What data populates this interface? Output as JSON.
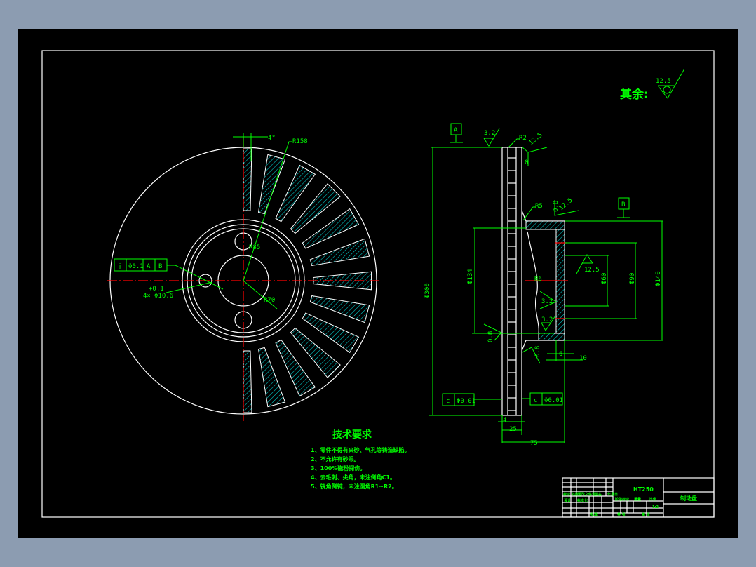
{
  "drawing": {
    "roughness_note": {
      "label": "其余:",
      "value": "12.5"
    },
    "colors": {
      "background": "#000000",
      "outline": "#ffffff",
      "dimension": "#00ff00",
      "centerline": "#ff0000",
      "hatch": "#00c8c8",
      "window": "#8c9cb1"
    },
    "front_view": {
      "angle": "4°",
      "radius_outer": "R158",
      "radius_mid": "R85",
      "radius_inner": "R70",
      "hole_count": "4×",
      "hole_dia": "Φ10.6",
      "hole_tol": "+0.1",
      "tolerance_frame": [
        "j",
        "Φ0.1",
        "A",
        "B"
      ]
    },
    "side_view": {
      "datum_a": "A",
      "datum_b": "B",
      "rough_top": "3.2",
      "radius_r2": "R2",
      "rough_corner": "12.5",
      "dim_small": "0",
      "radius_r5": "R5",
      "rough_hub_dim": "0.8",
      "rough_hub": "12.5",
      "rough_bore": "12.5",
      "rough_face1": "3.2",
      "rough_face2": "3.2",
      "rough_left": "0.8",
      "rough_right": "0.8",
      "dia_overall": "Φ300",
      "dia_134": "Φ134",
      "dia_60": "Φ60",
      "dia_90": "Φ90",
      "dia_140": "Φ140",
      "dim_r": "R6",
      "dim_6": "6",
      "dim_10": "10",
      "dim_4": "4",
      "dim_25": "25",
      "dim_75": "75",
      "flatness_left": [
        "c",
        "Φ0.01"
      ],
      "flatness_right": [
        "c",
        "Φ0.01"
      ]
    },
    "tech_requirements": {
      "title": "技术要求",
      "items": [
        "1、零件不得有夹砂、气孔等铸造缺陷。",
        "2、不允许有砂眼。",
        "3、100%磁粉探伤。",
        "4、去毛刺、尖角，未注倒角C1。",
        "5、锐角倒钝，未注圆角R1~R2。"
      ]
    },
    "title_block": {
      "material": "HT250",
      "part_name": "制动盘",
      "row_labels": [
        "标记",
        "处数",
        "分区",
        "更改文件号",
        "签名",
        "年月日"
      ],
      "row_labels2": [
        "设计",
        "标准化"
      ],
      "stage_labels": [
        "阶段标记",
        "重量",
        "比例"
      ],
      "scale": "1:2",
      "sheet_labels": [
        "共 张",
        "第 张"
      ],
      "approve": "批准",
      "craft": "工艺"
    }
  }
}
